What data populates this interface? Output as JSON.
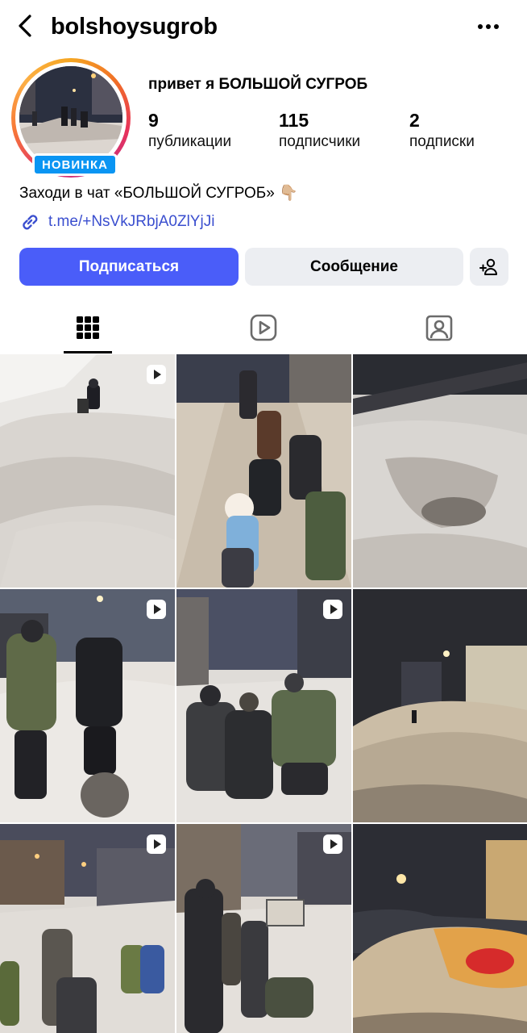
{
  "header": {
    "username": "bolshoysugrob",
    "back_icon": "chevron-left-icon",
    "more_icon": "more-horizontal-icon"
  },
  "profile": {
    "badge": "НОВИНКА",
    "name": "привет я БОЛЬШОЙ СУГРОБ",
    "stats": [
      {
        "value": "9",
        "label": "публикации"
      },
      {
        "value": "115",
        "label": "подписчики"
      },
      {
        "value": "2",
        "label": "подписки"
      }
    ],
    "bio": "Заходи в чат «БОЛЬШОЙ СУГРОБ» 👇🏼",
    "link": "t.me/+NsVkJRbjA0ZlYjJi"
  },
  "actions": {
    "follow": "Подписаться",
    "message": "Сообщение",
    "add_icon": "add-person-icon"
  },
  "tabs": [
    {
      "name": "grid",
      "icon": "grid-icon",
      "active": true
    },
    {
      "name": "reels",
      "icon": "reels-icon",
      "active": false
    },
    {
      "name": "tagged",
      "icon": "tagged-person-icon",
      "active": false
    }
  ],
  "colors": {
    "accent": "#4a5df9",
    "link": "#3b4fcf",
    "badge": "#0a95f3",
    "secondary_button": "#eceef2"
  },
  "posts": [
    {
      "scene": "snow-person-bending",
      "is_reel": true
    },
    {
      "scene": "crowd-snowy-street-night",
      "is_reel": false
    },
    {
      "scene": "snow-hole-fence",
      "is_reel": false
    },
    {
      "scene": "people-walking-snow",
      "is_reel": true
    },
    {
      "scene": "group-posing-snow",
      "is_reel": true
    },
    {
      "scene": "street-snow-pile-night",
      "is_reel": false
    },
    {
      "scene": "crowd-street-snow-dusk",
      "is_reel": true
    },
    {
      "scene": "group-with-sign",
      "is_reel": true
    },
    {
      "scene": "illuminated-snow-pile",
      "is_reel": false
    }
  ]
}
